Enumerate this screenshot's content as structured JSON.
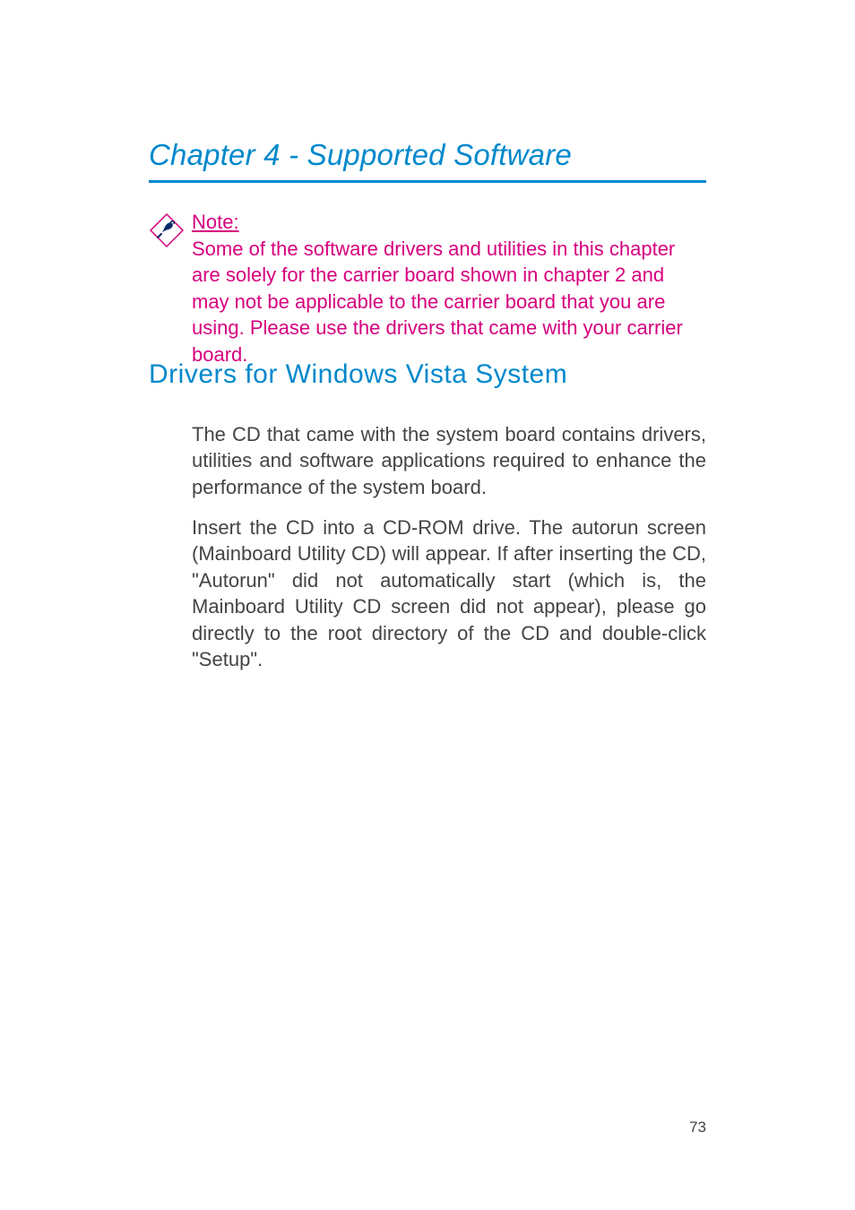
{
  "chapter": {
    "title": "Chapter 4 - Supported Software"
  },
  "note": {
    "label": "Note:",
    "text": "Some of the software drivers and utilities in this chapter are solely for the carrier board shown in chapter 2 and may not be applicable to the carrier board that you are using. Please use the drivers that came with your carrier board."
  },
  "section": {
    "heading": "Drivers for Windows Vista System",
    "para1": "The CD that came with the system board contains drivers, utilities and software applications required to enhance the performance of the system board.",
    "para2": "Insert the CD into a CD-ROM drive. The autorun screen (Mainboard Utility CD) will appear. If after inserting the CD, \"Autorun\" did not automatically start (which is, the Mainboard Utility CD screen did not appear), please go directly to the root directory of the CD and double-click \"Setup\"."
  },
  "page_number": "73"
}
